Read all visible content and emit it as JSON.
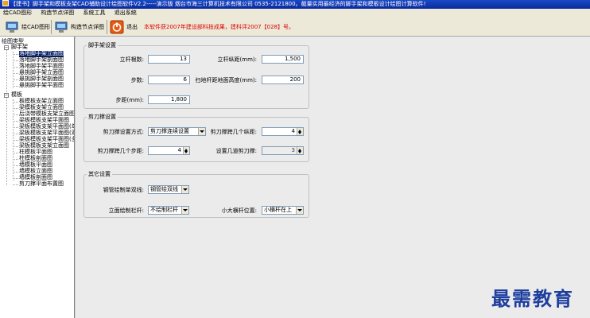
{
  "window": {
    "title": "【建书】脚手架和模板支架CAD辅助设计绘图软件V2.2-----演示版   烟台市海三计算机技术有限公司   0535-2121800。截量实用最经济的脚手架和模板设计绘图计算软件!"
  },
  "menu": {
    "items": [
      "绘CAD图形",
      "构造节点详图",
      "系统工具",
      "退出系统"
    ]
  },
  "toolbar": {
    "cad_label": "绘CAD图形",
    "node_label": "构造节点详图",
    "exit_label": "退出",
    "notice": "本软件获2007年建设部科技成果，建科评2007【028】号。"
  },
  "tree": {
    "header": "绘图类型",
    "scaffold": {
      "label": "脚手架",
      "children": [
        "落地脚手架立面图",
        "落地脚手架剖面图",
        "落地脚手架平面图",
        "悬挑脚手架立面图",
        "悬挑脚手架剖面图",
        "悬挑脚手架平面图"
      ]
    },
    "formwork": {
      "label": "模板",
      "children": [
        "板模板支架立面图",
        "梁模板支架立面图",
        "后浇带模板支架立面图",
        "梁板模板支架平面图",
        "梁板模板支架平面图(单排架)",
        "梁板模板支架平面图(双排架)",
        "梁板模板支架平面图(多排架)",
        "梁板模板支架立面图",
        "柱模板平面图",
        "柱模板剖面图",
        "墙模板平面图",
        "墙模板立面图",
        "墙模板剖面图",
        "剪刀撑平面布置图"
      ]
    }
  },
  "scaffold_settings": {
    "title": "脚手架设置",
    "pole_count_label": "立杆根数:",
    "pole_count": "13",
    "pole_spacing_label": "立杆纵距(mm):",
    "pole_spacing": "1,500",
    "steps_label": "步数:",
    "steps": "6",
    "sweep_height_label": "扫地杆距地面高度(mm):",
    "sweep_height": "200",
    "step_distance_label": "步距(mm):",
    "step_distance": "1,800"
  },
  "brace_settings": {
    "title": "剪刀撑设置",
    "mode_label": "剪刀撑设置方式:",
    "mode_value": "剪刀撑连续设置",
    "span_count_label": "剪刀撑跨几个纵距:",
    "span_count": "4",
    "step_count_label": "剪刀撑跨几个步距:",
    "step_count": "4",
    "brace_total_label": "设置几道剪刀撑:",
    "brace_total": "3"
  },
  "other_settings": {
    "title": "其它设置",
    "pipe_style_label": "钢管绘制单双线:",
    "pipe_style": "钢管绘双线",
    "rail_label": "立面绘制栏杆:",
    "rail_value": "不绘制栏杆",
    "small_rail_label": "小大横杆位置:",
    "small_rail_value": "小横杆在上"
  },
  "watermark": "最需教育"
}
